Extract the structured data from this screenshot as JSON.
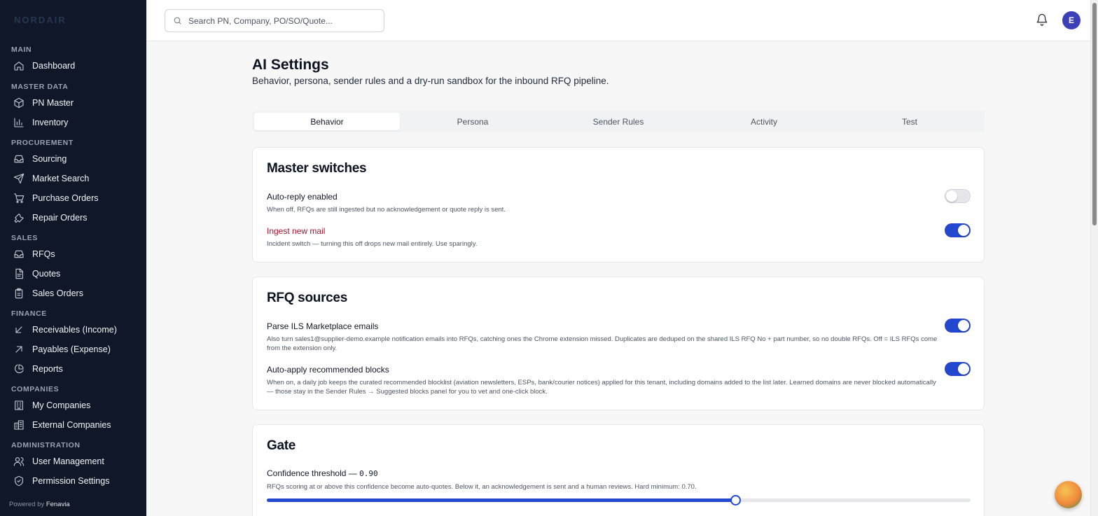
{
  "app": {
    "logo_text": "NORDAIR",
    "footer_prefix": "Powered by",
    "footer_brand": "Fenavia"
  },
  "search": {
    "placeholder": "Search PN, Company, PO/SO/Quote..."
  },
  "user": {
    "avatar_initial": "E"
  },
  "sidebar": {
    "sections": [
      {
        "label": "MAIN",
        "items": [
          {
            "label": "Dashboard",
            "icon": "home-icon"
          }
        ]
      },
      {
        "label": "MASTER DATA",
        "items": [
          {
            "label": "PN Master",
            "icon": "box-icon"
          },
          {
            "label": "Inventory",
            "icon": "bar-chart-icon"
          }
        ]
      },
      {
        "label": "PROCUREMENT",
        "items": [
          {
            "label": "Sourcing",
            "icon": "inbox-icon"
          },
          {
            "label": "Market Search",
            "icon": "send-icon"
          },
          {
            "label": "Purchase Orders",
            "icon": "cart-icon"
          },
          {
            "label": "Repair Orders",
            "icon": "wrench-icon"
          }
        ]
      },
      {
        "label": "SALES",
        "items": [
          {
            "label": "RFQs",
            "icon": "inbox-icon"
          },
          {
            "label": "Quotes",
            "icon": "document-icon"
          },
          {
            "label": "Sales Orders",
            "icon": "clipboard-icon"
          }
        ]
      },
      {
        "label": "FINANCE",
        "items": [
          {
            "label": "Receivables (Income)",
            "icon": "arrow-down-left-icon"
          },
          {
            "label": "Payables (Expense)",
            "icon": "arrow-up-right-icon"
          },
          {
            "label": "Reports",
            "icon": "pie-chart-icon"
          }
        ]
      },
      {
        "label": "COMPANIES",
        "items": [
          {
            "label": "My Companies",
            "icon": "building-icon"
          },
          {
            "label": "External Companies",
            "icon": "buildings-icon"
          }
        ]
      },
      {
        "label": "ADMINISTRATION",
        "items": [
          {
            "label": "User Management",
            "icon": "users-icon"
          },
          {
            "label": "Permission Settings",
            "icon": "shield-check-icon"
          }
        ]
      }
    ]
  },
  "page": {
    "title": "AI Settings",
    "subtitle": "Behavior, persona, sender rules and a dry-run sandbox for the inbound RFQ pipeline."
  },
  "tabs": [
    {
      "label": "Behavior",
      "active": true
    },
    {
      "label": "Persona",
      "active": false
    },
    {
      "label": "Sender Rules",
      "active": false
    },
    {
      "label": "Activity",
      "active": false
    },
    {
      "label": "Test",
      "active": false
    }
  ],
  "master_switches": {
    "title": "Master switches",
    "auto_reply": {
      "title": "Auto-reply enabled",
      "desc": "When off, RFQs are still ingested but no acknowledgement or quote reply is sent.",
      "enabled": false
    },
    "ingest": {
      "title": "Ingest new mail",
      "desc": "Incident switch — turning this off drops new mail entirely. Use sparingly.",
      "enabled": true,
      "title_color": "#a3122e"
    }
  },
  "rfq_sources": {
    "title": "RFQ sources",
    "parse_ils": {
      "title": "Parse ILS Marketplace emails",
      "desc": "Also turn sales1@supplier-demo.example notification emails into RFQs, catching ones the Chrome extension missed. Duplicates are deduped on the shared ILS RFQ No + part number, so no double RFQs. Off = ILS RFQs come from the extension only.",
      "enabled": true
    },
    "auto_apply": {
      "title": "Auto-apply recommended blocks",
      "desc": "When on, a daily job keeps the curated recommended blocklist (aviation newsletters, ESPs, bank/courier notices) applied for this tenant, including domains added to the list later. Learned domains are never blocked automatically — those stay in the Sender Rules → Suggested blocks panel for you to vet and one-click block.",
      "enabled": true
    }
  },
  "gate": {
    "title": "Gate",
    "threshold_label": "Confidence threshold — ",
    "threshold_value": "0.90",
    "threshold_fraction": 0.9,
    "desc": "RFQs scoring at or above this confidence become auto-quotes. Below it, an acknowledgement is sent and a human reviews. Hard minimum: 0.70."
  },
  "colors": {
    "accent": "#2447d0",
    "sidebar_bg": "#0f1729",
    "warning_text": "#a3122e",
    "avatar_bg": "#3b40b8"
  }
}
